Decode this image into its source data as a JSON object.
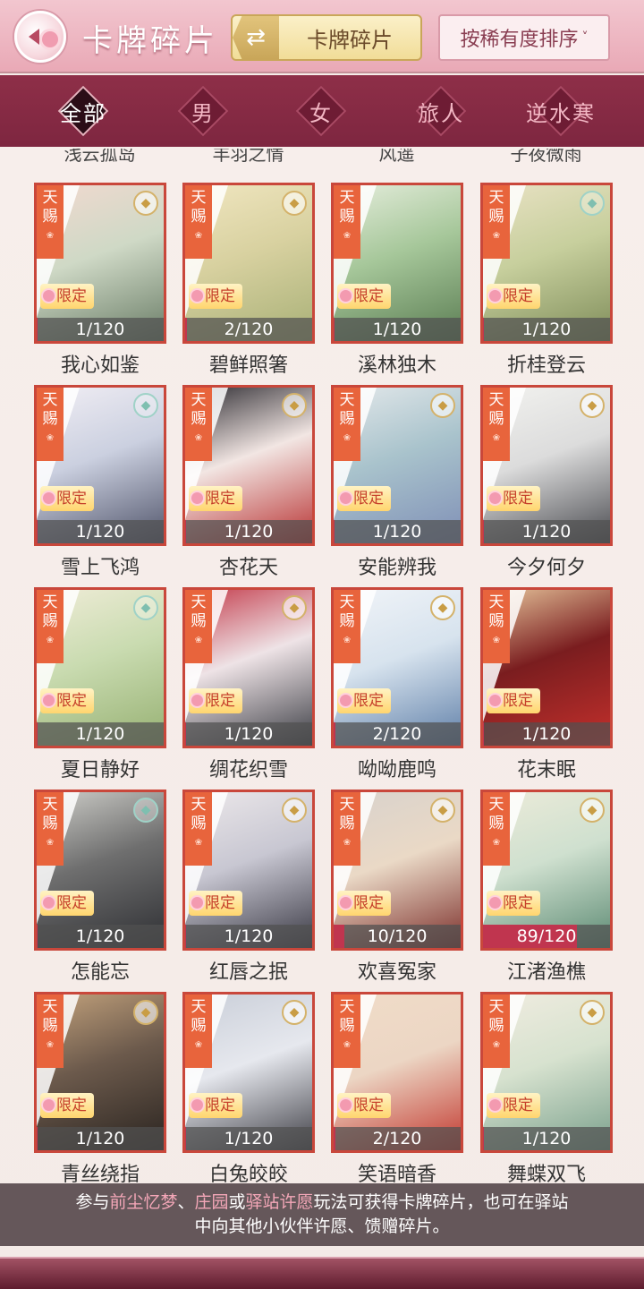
{
  "header": {
    "title": "卡牌碎片",
    "switch_label": "卡牌碎片",
    "switch_icon": "⇄",
    "sort_label": "按稀有度排序",
    "sort_icon": "˅"
  },
  "filters": [
    {
      "label": "全部",
      "active": true
    },
    {
      "label": "男",
      "active": false
    },
    {
      "label": "女",
      "active": false
    },
    {
      "label": "旅人",
      "active": false
    },
    {
      "label": "逆水寒",
      "active": false
    }
  ],
  "previous_row_names": [
    "浅云孤岛",
    "丰羽之情",
    "风遥",
    "子夜微雨"
  ],
  "card_tags": {
    "rarity": "天赐",
    "rarity_line1": "天",
    "rarity_line2": "赐",
    "limited": "限定"
  },
  "cards": [
    {
      "name": "我心如鉴",
      "count": "1/120",
      "progress": 0.0083,
      "badge": "coin",
      "colors": [
        "#cfd9c6",
        "#6a7d67",
        "#f1d9cf"
      ]
    },
    {
      "name": "碧鲜照箸",
      "count": "2/120",
      "progress": 0.0167,
      "badge": "coin",
      "colors": [
        "#d8d1a0",
        "#a8b077",
        "#f0e6c0"
      ]
    },
    {
      "name": "溪林独木",
      "count": "1/120",
      "progress": 0.0083,
      "badge": "none",
      "colors": [
        "#a6c79a",
        "#5b7d53",
        "#e5eddc"
      ]
    },
    {
      "name": "折桂登云",
      "count": "1/120",
      "progress": 0.0083,
      "badge": "dim",
      "colors": [
        "#c7cf9d",
        "#7f8d5a",
        "#e9e2c4"
      ]
    },
    {
      "name": "雪上飞鸿",
      "count": "1/120",
      "progress": 0.0083,
      "badge": "dim",
      "colors": [
        "#cbd0e0",
        "#50546a",
        "#f1eef4"
      ]
    },
    {
      "name": "杏花天",
      "count": "1/120",
      "progress": 0.0083,
      "badge": "coin",
      "colors": [
        "#f2e6e3",
        "#b83232",
        "#2c2a30"
      ]
    },
    {
      "name": "安能辨我",
      "count": "1/120",
      "progress": 0.0083,
      "badge": "coin",
      "colors": [
        "#a9c3cc",
        "#7f8fb6",
        "#e3e8ea"
      ]
    },
    {
      "name": "今夕何夕",
      "count": "1/120",
      "progress": 0.0083,
      "badge": "coin",
      "colors": [
        "#dcdcdc",
        "#4a4b50",
        "#f2f2ef"
      ]
    },
    {
      "name": "夏日静好",
      "count": "1/120",
      "progress": 0.0083,
      "badge": "dim",
      "colors": [
        "#c9dbb0",
        "#96b072",
        "#efecd7"
      ]
    },
    {
      "name": "绸花织雪",
      "count": "1/120",
      "progress": 0.0083,
      "badge": "coin",
      "colors": [
        "#eee3e6",
        "#3b3d44",
        "#c33a4a"
      ]
    },
    {
      "name": "呦呦鹿鸣",
      "count": "2/120",
      "progress": 0.0167,
      "badge": "coin",
      "colors": [
        "#d7e3ee",
        "#5f7fa8",
        "#f1f4f8"
      ]
    },
    {
      "name": "花末眠",
      "count": "1/120",
      "progress": 0.0083,
      "badge": "none",
      "colors": [
        "#7a1d1f",
        "#c4302c",
        "#e8c79d"
      ]
    },
    {
      "name": "怎能忘",
      "count": "1/120",
      "progress": 0.0083,
      "badge": "dim",
      "colors": [
        "#6f6f6f",
        "#2e2f33",
        "#cfcfca"
      ]
    },
    {
      "name": "红唇之抿",
      "count": "1/120",
      "progress": 0.0083,
      "badge": "coin",
      "colors": [
        "#c8c7d2",
        "#3a3944",
        "#ece8ea"
      ]
    },
    {
      "name": "欢喜冤家",
      "count": "10/120",
      "progress": 0.0833,
      "badge": "coin",
      "colors": [
        "#ead9c6",
        "#7c2f2b",
        "#d8d2cc"
      ]
    },
    {
      "name": "江渚渔樵",
      "count": "89/120",
      "progress": 0.7417,
      "badge": "coin",
      "colors": [
        "#cfe0cf",
        "#5c8a73",
        "#ecebd9"
      ]
    },
    {
      "name": "青丝绕指",
      "count": "1/120",
      "progress": 0.0083,
      "badge": "coin",
      "colors": [
        "#6c5a4c",
        "#2a2420",
        "#c4a37d"
      ]
    },
    {
      "name": "白兔皎皎",
      "count": "1/120",
      "progress": 0.0083,
      "badge": "coin",
      "colors": [
        "#e6e8ee",
        "#404047",
        "#c9ced8"
      ]
    },
    {
      "name": "笑语暗香",
      "count": "2/120",
      "progress": 0.0167,
      "badge": "none",
      "colors": [
        "#ecd6c4",
        "#c2382f",
        "#f0dcc8"
      ]
    },
    {
      "name": "舞蝶双飞",
      "count": "1/120",
      "progress": 0.0083,
      "badge": "coin",
      "colors": [
        "#d7e2cf",
        "#7aa08c",
        "#f0ece0"
      ]
    }
  ],
  "tip": {
    "line1_prefix": "参与",
    "link1": "前尘忆梦",
    "sep1": "、",
    "link2": "庄园",
    "sep2": "或",
    "link3": "驿站许愿",
    "line1_suffix": "玩法可获得卡牌碎片，也可在驿站",
    "line2": "中向其他小伙伴许愿、馈赠碎片。"
  }
}
